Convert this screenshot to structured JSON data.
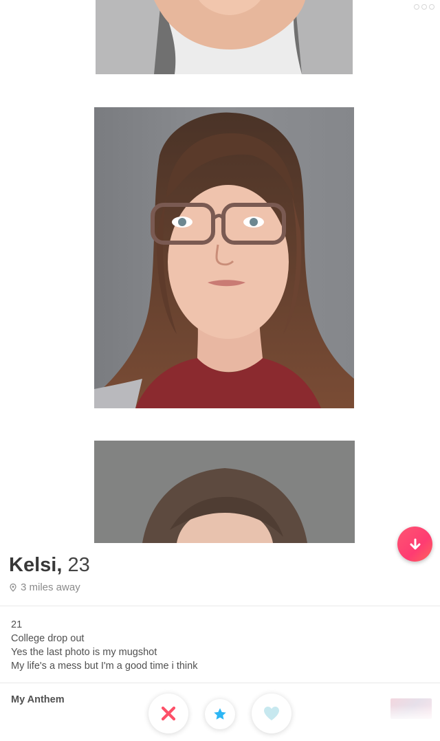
{
  "profile": {
    "name": "Kelsi,",
    "age": "23",
    "distance": "3 miles away"
  },
  "bio": {
    "lines": [
      "21",
      "College drop out",
      "Yes the last photo is my mugshot",
      "My life's a mess but I'm a good time i think"
    ]
  },
  "anthem": {
    "label": "My Anthem"
  },
  "icons": {
    "collapse": "arrow-down-icon",
    "distance": "location-pin-icon",
    "nope": "close-icon",
    "superlike": "star-icon",
    "like": "heart-icon"
  },
  "colors": {
    "brand": "#fe3c72",
    "nope": "#fd5068",
    "superlike": "#2db6f4",
    "like": "#b9e3ec"
  }
}
